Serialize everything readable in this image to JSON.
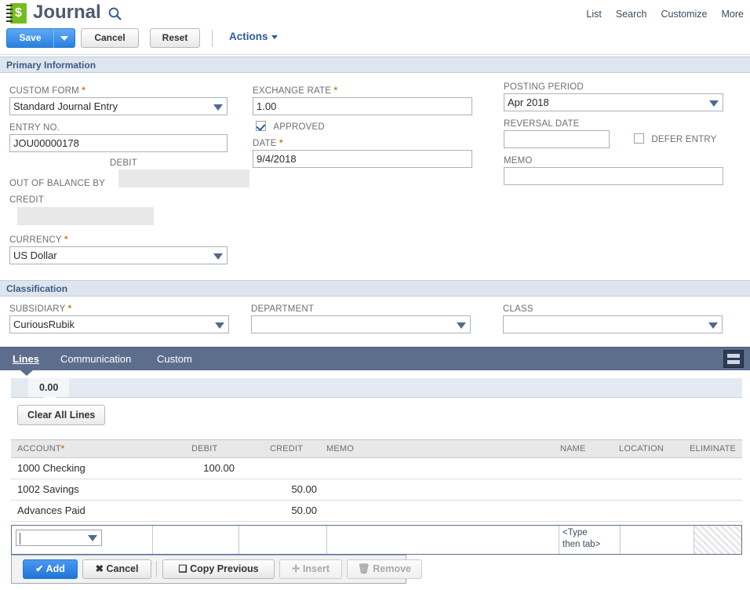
{
  "header": {
    "title": "Journal",
    "icon": "journal-dollar-icon",
    "search_icon": "search-icon",
    "nav_links": [
      "List",
      "Search",
      "Customize",
      "More"
    ]
  },
  "toolbar": {
    "save_label": "Save",
    "save_dropdown_icon": "chevron-down-icon",
    "cancel_label": "Cancel",
    "reset_label": "Reset",
    "actions_label": "Actions",
    "actions_caret_icon": "caret-down-icon"
  },
  "sections": {
    "primary": "Primary Information",
    "classification": "Classification"
  },
  "primary_information": {
    "custom_form": {
      "label": "CUSTOM FORM",
      "required": "*",
      "value": "Standard Journal Entry",
      "arrow_icon": "dropdown-arrow-icon"
    },
    "entry_no": {
      "label": "ENTRY NO.",
      "value": "JOU00000178"
    },
    "out_of_balance": {
      "label": "OUT OF BALANCE BY",
      "debit_label": "DEBIT",
      "debit_value": "",
      "credit_label": "CREDIT",
      "credit_value": ""
    },
    "currency": {
      "label": "CURRENCY",
      "required": "*",
      "value": "US Dollar",
      "arrow_icon": "dropdown-arrow-icon"
    },
    "exchange_rate": {
      "label": "EXCHANGE RATE",
      "required": "*",
      "value": "1.00"
    },
    "approved": {
      "label": "APPROVED",
      "checked": true
    },
    "date": {
      "label": "DATE",
      "required": "*",
      "value": "9/4/2018"
    },
    "posting_period": {
      "label": "POSTING PERIOD",
      "value": "Apr 2018",
      "arrow_icon": "dropdown-arrow-icon"
    },
    "reversal_date": {
      "label": "REVERSAL DATE",
      "value": ""
    },
    "defer_entry": {
      "label": "DEFER ENTRY",
      "checked": false
    },
    "memo": {
      "label": "MEMO",
      "value": ""
    }
  },
  "classification": {
    "subsidiary": {
      "label": "SUBSIDIARY",
      "required": "*",
      "value": "CuriousRubik",
      "arrow_icon": "dropdown-arrow-icon"
    },
    "department": {
      "label": "DEPARTMENT",
      "value": "",
      "arrow_icon": "dropdown-arrow-icon"
    },
    "class": {
      "label": "CLASS",
      "value": "",
      "arrow_icon": "dropdown-arrow-icon"
    }
  },
  "tabs": [
    {
      "label": "Lines",
      "active": true
    },
    {
      "label": "Communication",
      "active": false
    },
    {
      "label": "Custom",
      "active": false
    }
  ],
  "grid_toggle_icon": "list-view-icon",
  "subtab": {
    "label": "0.00"
  },
  "clear_all_lines_label": "Clear All Lines",
  "lines_grid": {
    "columns": [
      {
        "label": "ACCOUNT",
        "required": "*"
      },
      {
        "label": "DEBIT",
        "required": ""
      },
      {
        "label": "CREDIT",
        "required": ""
      },
      {
        "label": "MEMO",
        "required": ""
      },
      {
        "label": "NAME",
        "required": ""
      },
      {
        "label": "LOCATION",
        "required": ""
      },
      {
        "label": "ELIMINATE",
        "required": ""
      }
    ],
    "rows": [
      {
        "account": "1000 Checking",
        "debit": "100.00",
        "credit": "",
        "memo": "",
        "name": "",
        "location": "",
        "eliminate": ""
      },
      {
        "account": "1002 Savings",
        "debit": "",
        "credit": "50.00",
        "memo": "",
        "name": "",
        "location": "",
        "eliminate": ""
      },
      {
        "account": "Advances Paid",
        "debit": "",
        "credit": "50.00",
        "memo": "",
        "name": "",
        "location": "",
        "eliminate": ""
      }
    ],
    "edit_row": {
      "account_value": "",
      "account_arrow_icon": "dropdown-arrow-icon",
      "name_placeholder": "<Type\nthen tab>",
      "name_placeholder_line1": "<Type",
      "name_placeholder_line2": "then tab>"
    }
  },
  "line_buttons": [
    {
      "label": "Add",
      "icon": "check-icon",
      "style": "primary",
      "enabled": true
    },
    {
      "label": "Cancel",
      "icon": "x-icon",
      "style": "default",
      "enabled": true
    },
    {
      "label": "Copy Previous",
      "icon": "copy-icon",
      "style": "default",
      "enabled": true
    },
    {
      "label": "Insert",
      "icon": "plus-icon",
      "style": "default",
      "enabled": false
    },
    {
      "label": "Remove",
      "icon": "trash-icon",
      "style": "default",
      "enabled": false
    }
  ],
  "colors": {
    "accent_blue": "#2a80e0",
    "tab_bar": "#5d6e8c",
    "section_band": "#dfe5ee",
    "brand_green": "#76bc21",
    "required_star": "#c77b23"
  }
}
